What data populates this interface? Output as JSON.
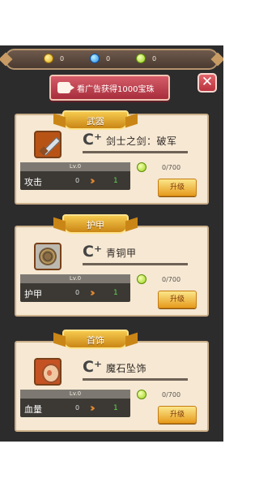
{
  "resources": [
    {
      "icon": "gold-coin-icon",
      "value": "0"
    },
    {
      "icon": "blue-gem-icon",
      "value": "0"
    },
    {
      "icon": "green-pearl-icon",
      "value": "0"
    }
  ],
  "ad_button_label": "看广告获得1000宝珠",
  "close_label": "✕",
  "cards": [
    {
      "section": "武器",
      "name": "剑士之剑：破军",
      "level": "Lv.0",
      "stat_label": "攻击",
      "stat_value": "0",
      "next_value": "1",
      "cost": "0/700",
      "upgrade_label": "升级"
    },
    {
      "section": "护甲",
      "name": "青铜甲",
      "level": "Lv.0",
      "stat_label": "护甲",
      "stat_value": "0",
      "next_value": "1",
      "cost": "0/700",
      "upgrade_label": "升级"
    },
    {
      "section": "首饰",
      "name": "魔石坠饰",
      "level": "Lv.0",
      "stat_label": "血量",
      "stat_value": "0",
      "next_value": "1",
      "cost": "0/700",
      "upgrade_label": "升级"
    }
  ],
  "colors": {
    "background": "#2d2c2d",
    "card": "#f6e8d3",
    "accent": "#f4b630",
    "ad": "#c94454"
  }
}
